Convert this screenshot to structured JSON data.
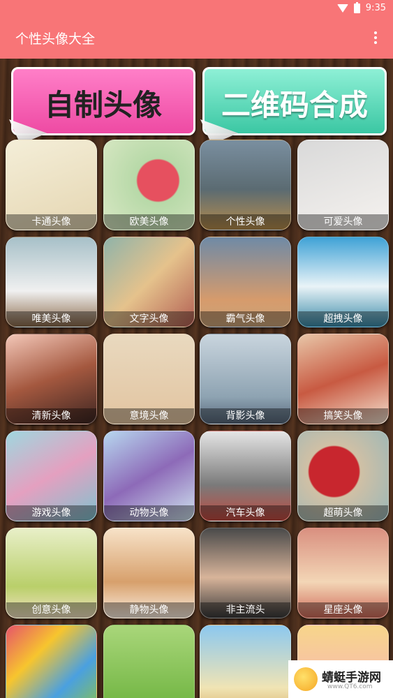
{
  "status": {
    "time": "9:35"
  },
  "app": {
    "title": "个性头像大全"
  },
  "banners": {
    "left": "自制头像",
    "right": "二维码合成"
  },
  "tiles": [
    {
      "label": "卡通头像",
      "bg": "linear-gradient(160deg,#f4eed8,#e5d6b2)"
    },
    {
      "label": "欧美头像",
      "bg": "radial-gradient(circle at 60% 45%,#e6505f 0 28%,#b7d9a8 30%,#d9e8c4)"
    },
    {
      "label": "个性头像",
      "bg": "linear-gradient(#7a8fa0,#5b6b72 55%,#b68c4c)"
    },
    {
      "label": "可爱头像",
      "bg": "linear-gradient(160deg,#d9d9d9,#f5f2ef)"
    },
    {
      "label": "唯美头像",
      "bg": "linear-gradient(#a7c0c8,#f0f0f0 60%,#8a6a4b)"
    },
    {
      "label": "文字头像",
      "bg": "linear-gradient(135deg,#8fb3a9,#e5c28c,#b25f53)"
    },
    {
      "label": "霸气头像",
      "bg": "linear-gradient(#6f8aa6,#d69b6c 70%,#caa47a)"
    },
    {
      "label": "超拽头像",
      "bg": "linear-gradient(#3fa2d6,#e9f3f7 55%,#3a8aa8)"
    },
    {
      "label": "清新头像",
      "bg": "linear-gradient(160deg,#f3c7b8,#a4583f,#3d2622)"
    },
    {
      "label": "意境头像",
      "bg": "linear-gradient(#e9d9bf,#e2c4a0)"
    },
    {
      "label": "背影头像",
      "bg": "linear-gradient(#c9d5de,#8ea3b2 70%,#56677a)"
    },
    {
      "label": "搞笑头像",
      "bg": "linear-gradient(160deg,#e8c6a8,#c85a42,#f4e2d0)"
    },
    {
      "label": "游戏头像",
      "bg": "linear-gradient(150deg,#9fd7df,#e4a0c0,#7fc2cf)"
    },
    {
      "label": "动物头像",
      "bg": "linear-gradient(150deg,#b7d7ef,#8d6ab8,#d0e5f0)"
    },
    {
      "label": "汽车头像",
      "bg": "linear-gradient(#e5e5e5,#7a7a7a 60%,#c24a40)"
    },
    {
      "label": "超萌头像",
      "bg": "radial-gradient(circle at 40% 45%,#c8262e 0 34%,#d0c0a5 36%,#9ab7b8)"
    },
    {
      "label": "创意头像",
      "bg": "linear-gradient(#e8efc8,#b9cf6a 65%,#f2e2c2)"
    },
    {
      "label": "静物头像",
      "bg": "linear-gradient(#f7e2c8,#d7a06c 60%,#fbeee0)"
    },
    {
      "label": "非主流头",
      "bg": "linear-gradient(#4a4a4a,#d8b49a 55%,#3a3a3a)"
    },
    {
      "label": "星座头像",
      "bg": "linear-gradient(#d99080,#f3d6b6 60%,#cf6b5a)"
    },
    {
      "label": "",
      "bg": "linear-gradient(135deg,#e6546a,#f7c52e,#4aa0e0,#8bc34a)"
    },
    {
      "label": "",
      "bg": "linear-gradient(#a9d67a,#6bb23c)"
    },
    {
      "label": "",
      "bg": "linear-gradient(#8cc8ef,#f0e4b4 70%,#d7b06a)"
    },
    {
      "label": "",
      "bg": "linear-gradient(#f7d58a,#f7b0c0)"
    }
  ],
  "watermark": {
    "text": "蜻蜓手游网",
    "sub": "www.QT6.com"
  }
}
